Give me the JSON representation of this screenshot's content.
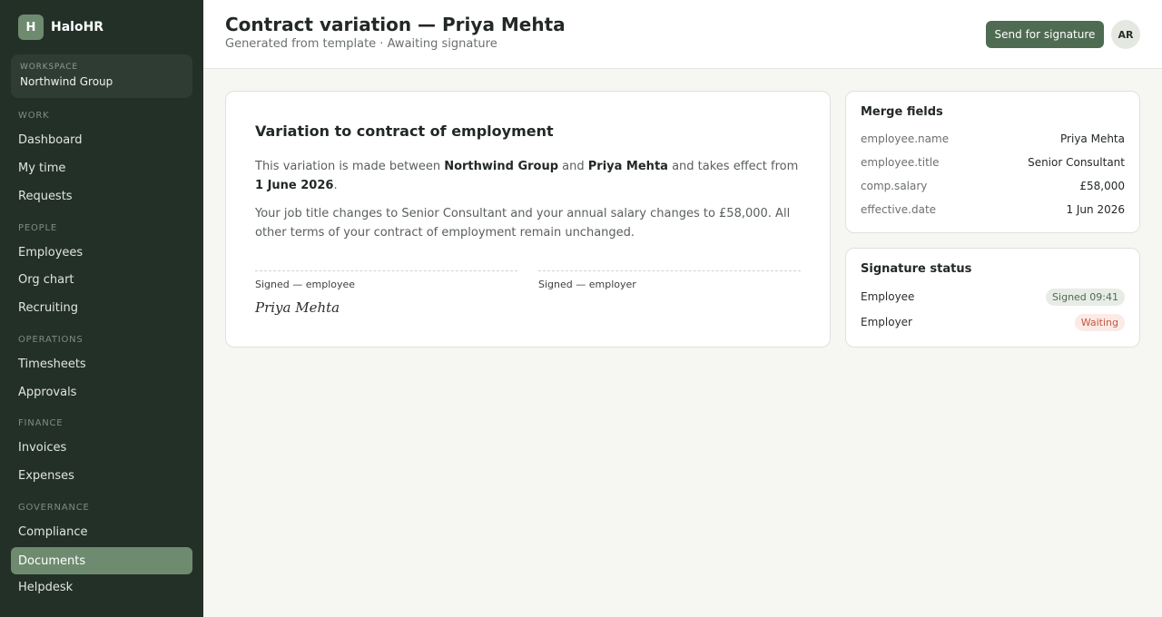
{
  "app": {
    "logo_letter": "H",
    "name": "HaloHR"
  },
  "workspace": {
    "label": "WORKSPACE",
    "name": "Northwind Group"
  },
  "sidebar": {
    "sections": [
      {
        "label": "WORK",
        "items": [
          "Dashboard",
          "My time",
          "Requests"
        ]
      },
      {
        "label": "PEOPLE",
        "items": [
          "Employees",
          "Org chart",
          "Recruiting"
        ]
      },
      {
        "label": "OPERATIONS",
        "items": [
          "Timesheets",
          "Approvals"
        ]
      },
      {
        "label": "FINANCE",
        "items": [
          "Invoices",
          "Expenses"
        ]
      },
      {
        "label": "GOVERNANCE",
        "items": [
          "Compliance",
          "Documents",
          "Helpdesk"
        ]
      }
    ],
    "active_item": "Documents"
  },
  "header": {
    "title": "Contract variation — Priya Mehta",
    "subtitle": "Generated from template · Awaiting signature",
    "send_button": "Send for signature",
    "avatar_initials": "AR"
  },
  "document": {
    "title": "Variation to contract of employment",
    "para1": {
      "t1": "This variation is made between ",
      "company": "Northwind Group",
      "t2": " and ",
      "employee": "Priya Mehta",
      "t3": " and takes effect from ",
      "date": "1 June 2026",
      "t4": "."
    },
    "para2": "Your job title changes to Senior Consultant and your annual salary changes to £58,000. All other terms of your contract of employment remain unchanged.",
    "sig_employee_label": "Signed — employee",
    "sig_employer_label": "Signed — employer",
    "employee_signature": "Priya Mehta"
  },
  "merge_fields": {
    "title": "Merge fields",
    "rows": [
      {
        "key": "employee.name",
        "value": "Priya Mehta"
      },
      {
        "key": "employee.title",
        "value": "Senior Consultant"
      },
      {
        "key": "comp.salary",
        "value": "£58,000"
      },
      {
        "key": "effective.date",
        "value": "1 Jun 2026"
      }
    ]
  },
  "signature_status": {
    "title": "Signature status",
    "rows": [
      {
        "party": "Employee",
        "status": "Signed 09:41",
        "state": "signed"
      },
      {
        "party": "Employer",
        "status": "Waiting",
        "state": "waiting"
      }
    ]
  },
  "colors": {
    "sidebar_bg": "#233028",
    "accent": "#6e8b6f",
    "primary_button": "#4f6b52",
    "waiting": "#c4573f"
  }
}
